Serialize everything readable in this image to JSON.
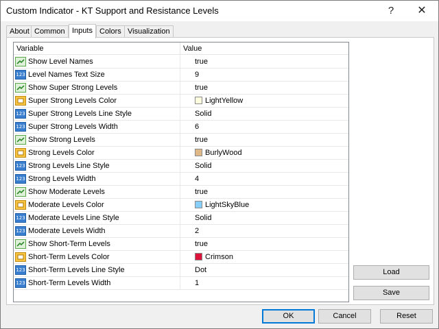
{
  "window": {
    "title": "Custom Indicator - KT Support and Resistance Levels",
    "help_glyph": "?",
    "close_glyph": "✕"
  },
  "tabs": [
    {
      "label": "About",
      "active": false
    },
    {
      "label": "Common",
      "active": false
    },
    {
      "label": "Inputs",
      "active": true
    },
    {
      "label": "Colors",
      "active": false
    },
    {
      "label": "Visualization",
      "active": false
    }
  ],
  "table": {
    "headers": {
      "variable": "Variable",
      "value": "Value"
    },
    "rows": [
      {
        "type": "bool",
        "icon": "bool-icon",
        "variable": "Show Level Names",
        "value": "true"
      },
      {
        "type": "int",
        "icon": "int-icon",
        "variable": "Level Names Text Size",
        "value": "9"
      },
      {
        "type": "bool",
        "icon": "bool-icon",
        "variable": "Show Super Strong Levels",
        "value": "true"
      },
      {
        "type": "color",
        "icon": "color-icon",
        "variable": "Super Strong Levels Color",
        "value": "LightYellow",
        "swatch": "#ffffe0"
      },
      {
        "type": "int",
        "icon": "int-icon",
        "variable": "Super Strong Levels Line Style",
        "value": "Solid"
      },
      {
        "type": "int",
        "icon": "int-icon",
        "variable": "Super Strong Levels Width",
        "value": "6"
      },
      {
        "type": "bool",
        "icon": "bool-icon",
        "variable": "Show Strong Levels",
        "value": "true"
      },
      {
        "type": "color",
        "icon": "color-icon",
        "variable": "Strong Levels Color",
        "value": "BurlyWood",
        "swatch": "#deb887"
      },
      {
        "type": "int",
        "icon": "int-icon",
        "variable": "Strong Levels Line Style",
        "value": "Solid"
      },
      {
        "type": "int",
        "icon": "int-icon",
        "variable": "Strong Levels Width",
        "value": "4"
      },
      {
        "type": "bool",
        "icon": "bool-icon",
        "variable": "Show Moderate Levels",
        "value": "true"
      },
      {
        "type": "color",
        "icon": "color-icon",
        "variable": "Moderate Levels Color",
        "value": "LightSkyBlue",
        "swatch": "#87cefa"
      },
      {
        "type": "int",
        "icon": "int-icon",
        "variable": "Moderate Levels Line Style",
        "value": "Solid"
      },
      {
        "type": "int",
        "icon": "int-icon",
        "variable": "Moderate Levels Width",
        "value": "2"
      },
      {
        "type": "bool",
        "icon": "bool-icon",
        "variable": "Show Short-Term Levels",
        "value": "true"
      },
      {
        "type": "color",
        "icon": "color-icon",
        "variable": "Short-Term Levels Color",
        "value": "Crimson",
        "swatch": "#dc143c"
      },
      {
        "type": "int",
        "icon": "int-icon",
        "variable": "Short-Term Levels Line Style",
        "value": "Dot"
      },
      {
        "type": "int",
        "icon": "int-icon",
        "variable": "Short-Term Levels Width",
        "value": "1"
      }
    ]
  },
  "side_buttons": {
    "load": "Load",
    "save": "Save"
  },
  "footer_buttons": {
    "ok": "OK",
    "cancel": "Cancel",
    "reset": "Reset"
  },
  "icon_text": {
    "int": "123"
  }
}
